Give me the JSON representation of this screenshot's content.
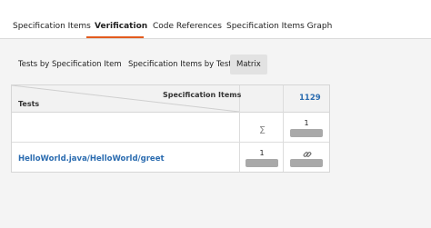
{
  "tabs": [
    {
      "label": "Specification Items"
    },
    {
      "label": "Verification"
    },
    {
      "label": "Code References"
    },
    {
      "label": "Specification Items Graph"
    }
  ],
  "subtabs": [
    {
      "label": "Tests by Specification Item"
    },
    {
      "label": "Specification Items by Test"
    },
    {
      "label": "Matrix"
    }
  ],
  "matrix": {
    "spec_header": "Specification Items",
    "tests_header": "Tests",
    "requirement": "1129",
    "sigma": "Σ",
    "sum_count": "1",
    "test_name": "HelloWorld.java/HelloWorld/greet",
    "test_count": "1"
  },
  "colors": {
    "accent": "#e35b1e",
    "link": "#2b6cb0",
    "bar": "#a9a9a9"
  }
}
